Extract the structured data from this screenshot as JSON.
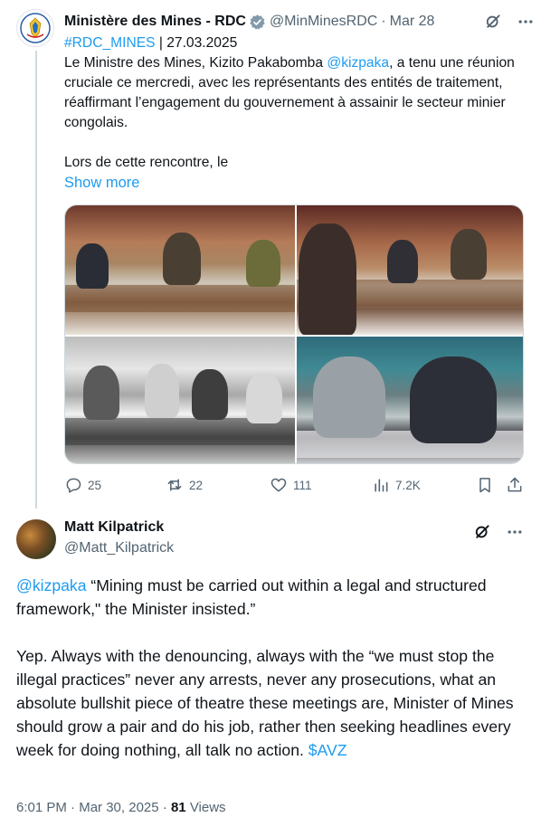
{
  "parent_tweet": {
    "author_name": "Ministère des Mines - RDC",
    "handle": "@MinMinesRDC",
    "date": "Mar 28",
    "hashtag": "#RDC_MINES",
    "date_tag": "| 27.03.2025",
    "body_part1": "Le Ministre des Mines, Kizito Pakabomba ",
    "mention": "@kizpaka",
    "body_part2": ", a tenu une réunion cruciale ce mercredi, avec les représentants des entités de traitement, réaffirmant l’engagement du gouvernement à assainir le secteur minier congolais.",
    "body_part3": "Lors de cette rencontre, le",
    "show_more": "Show more",
    "replies": "25",
    "retweets": "22",
    "likes": "111",
    "views": "7.2K"
  },
  "main_tweet": {
    "author_name": "Matt Kilpatrick",
    "handle": "@Matt_Kilpatrick",
    "mention": "@kizpaka",
    "quote": " “Mining must be carried out within a legal and structured framework,\" the Minister insisted.”",
    "body": "Yep. Always with the denouncing, always with the “we must stop the illegal practices” never any arrests, never any prosecutions, what an absolute bullshit piece of theatre these meetings are, Minister of Mines should grow a pair and do his job, rather then seeking headlines every week for doing nothing, all talk no action. ",
    "cashtag": "$AVZ",
    "time": "6:01 PM",
    "date": "Mar 30, 2025",
    "views_count": "81",
    "views_label": "Views"
  },
  "colors": {
    "accent": "#1d9bf0",
    "secondary_text": "#536471",
    "verified": "#829aab"
  },
  "icons": {
    "verified": "verified-badge-icon",
    "grok": "grok-icon",
    "more": "more-icon",
    "reply": "reply-icon",
    "retweet": "retweet-icon",
    "like": "like-icon",
    "views": "views-icon",
    "bookmark": "bookmark-icon",
    "share": "share-icon"
  }
}
